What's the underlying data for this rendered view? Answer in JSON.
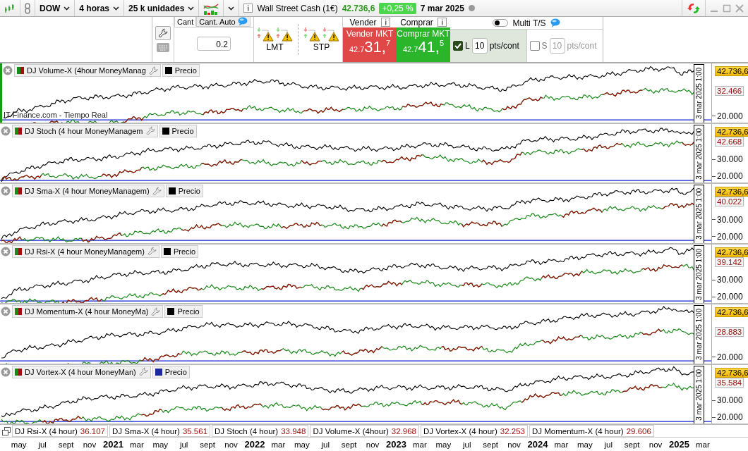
{
  "toolbar": {
    "instrument": "DOW",
    "timeframe": "4 horas",
    "units": "25 k unidades",
    "title": "Wall Street Cash (1€)",
    "price": "42.736,6",
    "change": "+0,25 %",
    "date": "7 mar 2025"
  },
  "order_panel": {
    "tabs": [
      {
        "label": "Cant",
        "selected": true
      },
      {
        "label": "Cant. Auto",
        "selected": false
      }
    ],
    "quantity": "0.2",
    "limit_label": "LMT",
    "stop_label": "STP",
    "sell": {
      "header": "Vender",
      "button": "Vender MKT",
      "price_prefix": "42.7",
      "price_main": "31,",
      "price_sup": "7"
    },
    "buy": {
      "header": "Comprar",
      "button": "Comprar MKT",
      "price_prefix": "42.7",
      "price_main": "41,",
      "price_sup": "5"
    },
    "multi_ts": {
      "label": "Multi T/S",
      "on": false
    },
    "long": {
      "label": "L",
      "checked": true,
      "disabled": false,
      "value": "10",
      "unit": "pts/cont"
    },
    "short": {
      "label": "S",
      "checked": false,
      "disabled": true,
      "value": "10",
      "unit": "pts/cont"
    }
  },
  "panes": [
    {
      "name": "DJ Volume-X (4hour MoneyManag",
      "price_label": "Precio",
      "color": "#000000",
      "date_label": "3 mar 2025 1:00",
      "price_badge": "42.736,6",
      "value_badge": "32.466",
      "ticks": [
        "20.000"
      ],
      "watermark": "IT-Finance.com - Tiempo Real"
    },
    {
      "name": "DJ Stoch (4 hour MoneyManagem",
      "price_label": "Precio",
      "color": "#000000",
      "date_label": "3 mar 2025 1:00",
      "price_badge": "42.736,6",
      "value_badge": "42.668",
      "ticks": [
        "30.000",
        "20.000"
      ]
    },
    {
      "name": "DJ Sma-X (4 hour MoneyManagem)",
      "price_label": "Precio",
      "color": "#000000",
      "date_label": "3 mar 2025 1:00",
      "price_badge": "42.736,6",
      "value_badge": "40.022",
      "ticks": [
        "30.000",
        "20.000"
      ]
    },
    {
      "name": "DJ Rsi-X (4 hour MoneyManagem)",
      "price_label": "Precio",
      "color": "#000000",
      "date_label": "3 mar 2025 1:00",
      "price_badge": "42.736,6",
      "value_badge": "39.142",
      "ticks": [
        "30.000",
        "20.000"
      ]
    },
    {
      "name": "DJ Momentum-X (4 hour MoneyMa)",
      "price_label": "Precio",
      "color": "#000000",
      "date_label": "3 mar 2025 1:00",
      "price_badge": "42.736,6",
      "value_badge": "28.883",
      "ticks": [
        "20.000"
      ]
    },
    {
      "name": "DJ  Vortex-X (4 hour MoneyMan)",
      "price_label": "Precio",
      "color": "#1a2a9a",
      "date_label": "3 mar 2025 1:00",
      "price_badge": "42.736,6",
      "value_badge": "35.584",
      "ticks": [
        "30.000",
        "20.000"
      ]
    }
  ],
  "bottom_legend": [
    {
      "name": "DJ Rsi-X (4 hour)",
      "value": "36.107"
    },
    {
      "name": "DJ Sma-X (4 hour)",
      "value": "35.561"
    },
    {
      "name": "DJ Stoch (4 hour)",
      "value": "33.948"
    },
    {
      "name": "DJ Volume-X (4hour)",
      "value": "32.968"
    },
    {
      "name": "DJ  Vortex-X (4 hour)",
      "value": "32.253"
    },
    {
      "name": "DJ Momentum-X (4 hour)",
      "value": "29.606"
    }
  ],
  "x_axis": [
    {
      "label": "may",
      "kind": "month"
    },
    {
      "label": "jul",
      "kind": "month"
    },
    {
      "label": "sept",
      "kind": "month"
    },
    {
      "label": "nov",
      "kind": "month"
    },
    {
      "label": "2021",
      "kind": "year"
    },
    {
      "label": "mar",
      "kind": "month"
    },
    {
      "label": "may",
      "kind": "month"
    },
    {
      "label": "jul",
      "kind": "month"
    },
    {
      "label": "sept",
      "kind": "month"
    },
    {
      "label": "nov",
      "kind": "month"
    },
    {
      "label": "2022",
      "kind": "year"
    },
    {
      "label": "mar",
      "kind": "month"
    },
    {
      "label": "may",
      "kind": "month"
    },
    {
      "label": "jul",
      "kind": "month"
    },
    {
      "label": "sept",
      "kind": "month"
    },
    {
      "label": "nov",
      "kind": "month"
    },
    {
      "label": "2023",
      "kind": "year"
    },
    {
      "label": "mar",
      "kind": "month"
    },
    {
      "label": "may",
      "kind": "month"
    },
    {
      "label": "jul",
      "kind": "month"
    },
    {
      "label": "sept",
      "kind": "month"
    },
    {
      "label": "nov",
      "kind": "month"
    },
    {
      "label": "2024",
      "kind": "year"
    },
    {
      "label": "mar",
      "kind": "month"
    },
    {
      "label": "may",
      "kind": "month"
    },
    {
      "label": "jul",
      "kind": "month"
    },
    {
      "label": "sept",
      "kind": "month"
    },
    {
      "label": "nov",
      "kind": "month"
    },
    {
      "label": "2025",
      "kind": "year"
    },
    {
      "label": "mar",
      "kind": "month"
    }
  ]
}
